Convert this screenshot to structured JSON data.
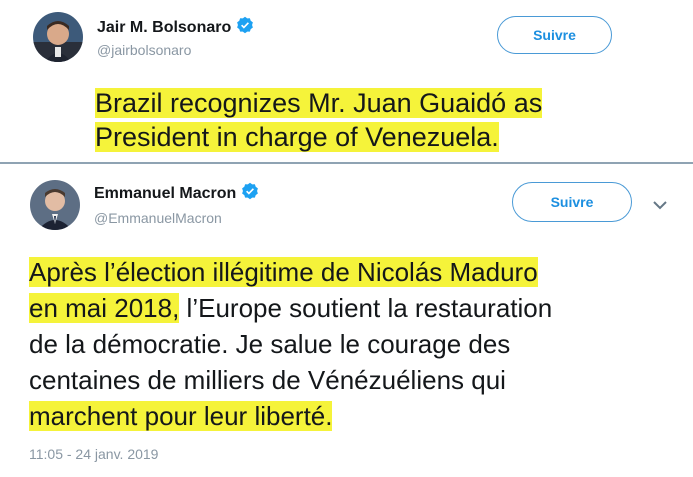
{
  "tweets": [
    {
      "author_name": "Jair M. Bolsonaro",
      "handle": "@jairbolsonaro",
      "follow_label": "Suivre",
      "verified_icon": "verified-badge-icon",
      "text_lines": [
        "Brazil recognizes Mr. Juan Guaidó as",
        "President in charge of Venezuela."
      ]
    },
    {
      "author_name": "Emmanuel Macron",
      "handle": "@EmmanuelMacron",
      "follow_label": "Suivre",
      "verified_icon": "verified-badge-icon",
      "more_icon": "chevron-down-icon",
      "text_lines": [
        {
          "hl": "Après l’élection illégitime de Nicolás Maduro",
          "rest": ""
        },
        {
          "hl": "en mai 2018,",
          "rest": " l’Europe soutient la restauration"
        },
        {
          "hl": "",
          "rest": "de la démocratie. Je salue le courage des"
        },
        {
          "hl": "",
          "rest": "centaines de milliers de Vénézuéliens qui"
        },
        {
          "hl": "marchent pour leur liberté.",
          "rest": ""
        }
      ],
      "timestamp": "11:05 - 24 janv. 2019"
    }
  ],
  "colors": {
    "highlight": "#f5f33a",
    "link_blue": "#1c8fe0",
    "verified_blue": "#1da1f2",
    "muted_gray": "#8a97a3"
  }
}
